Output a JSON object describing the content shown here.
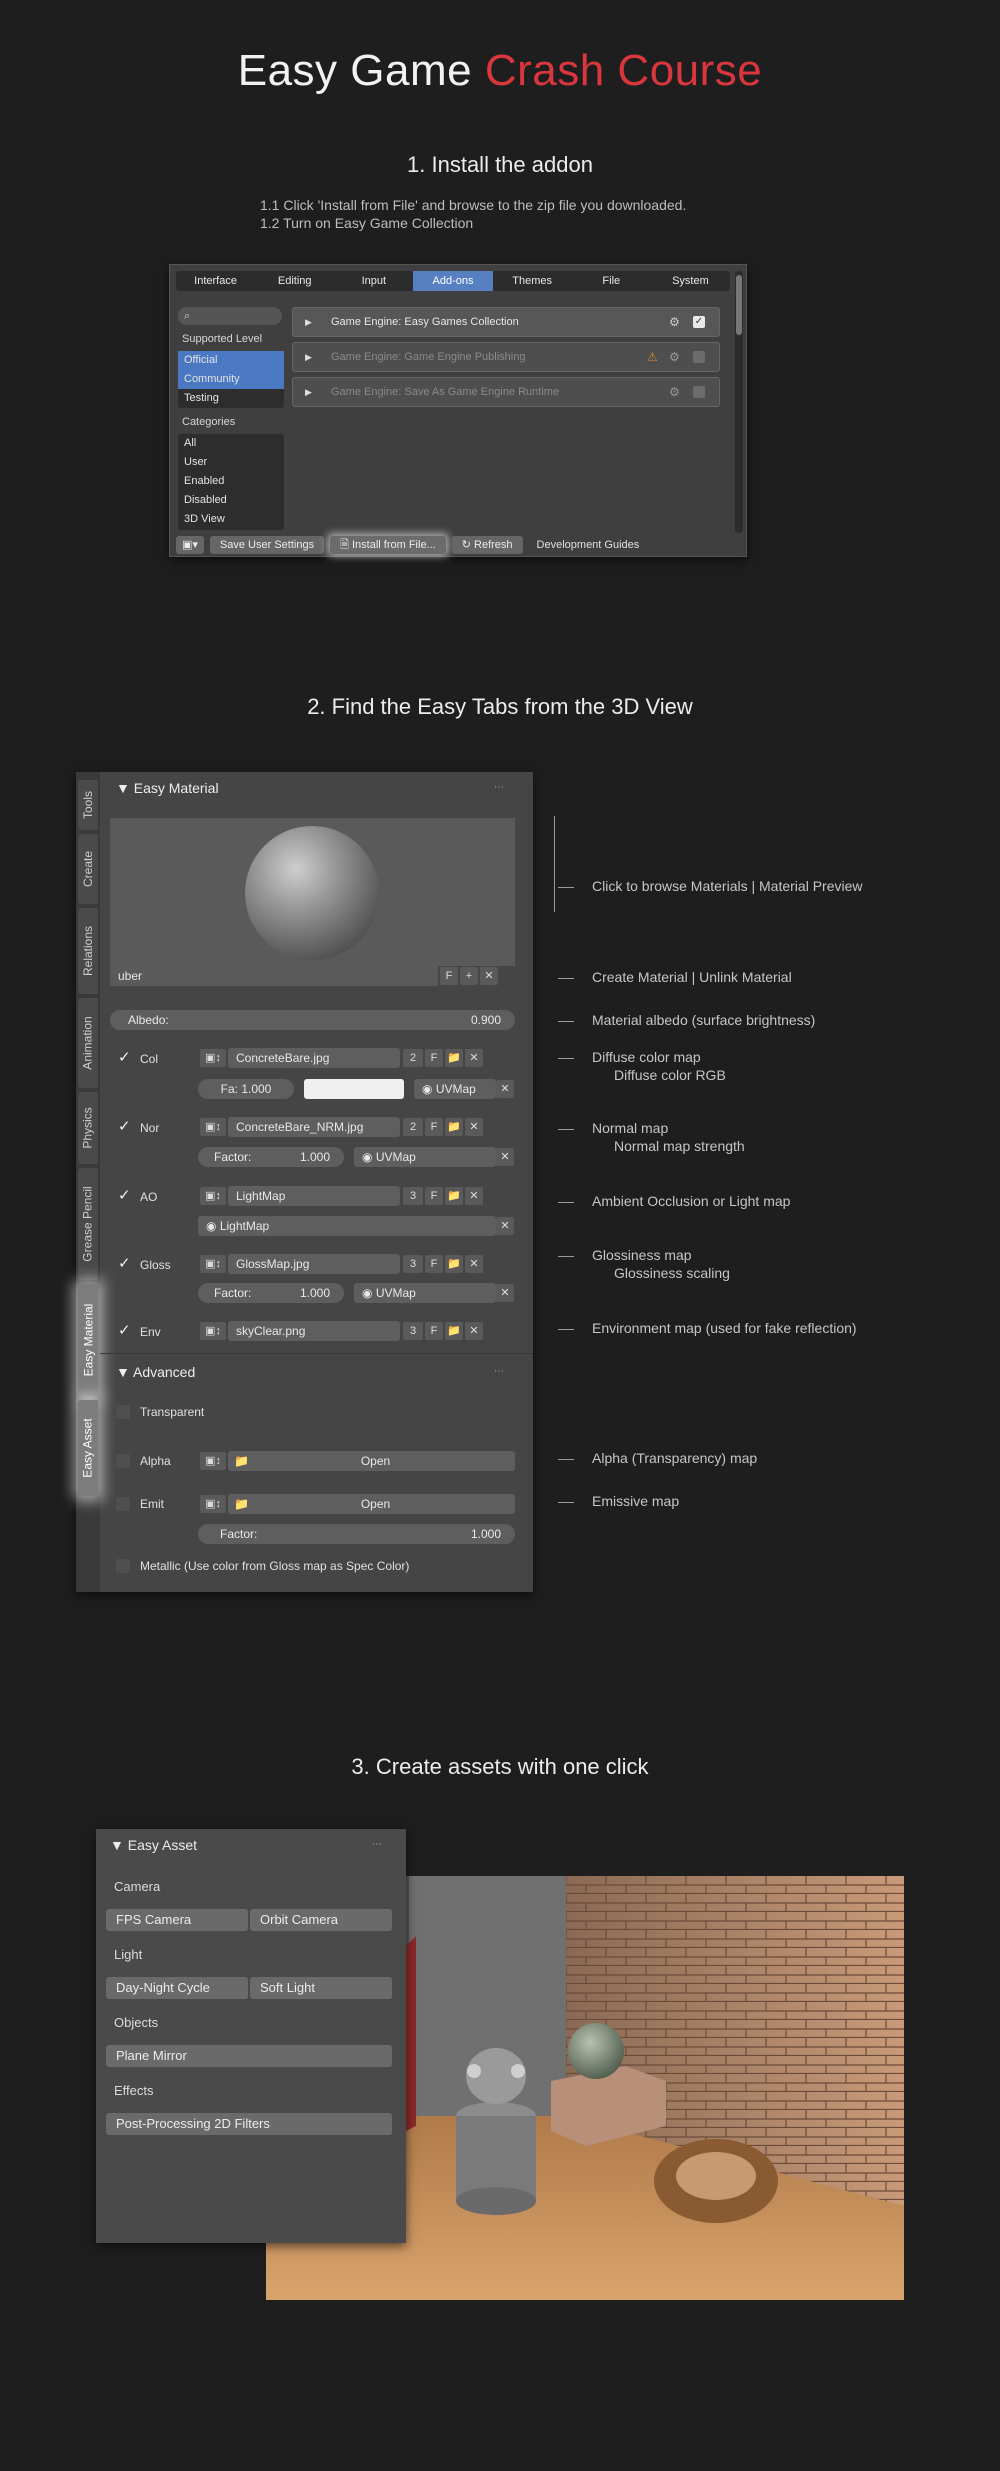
{
  "page": {
    "title_plain": "Easy Game ",
    "title_accent": "Crash Course",
    "accent_color": "#d9363e"
  },
  "step1": {
    "heading": "1. Install the addon",
    "lines": [
      "1.1 Click 'Install from File' and browse to the zip file you downloaded.",
      "1.2 Turn on Easy Game Collection"
    ],
    "tabs": [
      "Interface",
      "Editing",
      "Input",
      "Add-ons",
      "Themes",
      "File",
      "System"
    ],
    "active_tab": "Add-ons",
    "supported_level_label": "Supported Level",
    "levels": [
      "Official",
      "Community",
      "Testing"
    ],
    "categories_label": "Categories",
    "categories": [
      "All",
      "User",
      "Enabled",
      "Disabled",
      "3D View"
    ],
    "addons": [
      "Game Engine: Easy Games Collection",
      "Game Engine: Game Engine Publishing",
      "Game Engine: Save As Game Engine Runtime"
    ],
    "footer": {
      "save": "Save User Settings",
      "install": "Install from File...",
      "refresh": "Refresh",
      "guides": "Development Guides"
    }
  },
  "step2": {
    "heading": "2. Find the Easy Tabs from the 3D View",
    "vtabs": [
      "Tools",
      "Create",
      "Relations",
      "Animation",
      "Physics",
      "Grease Pencil",
      "Easy Material",
      "Easy Asset"
    ],
    "panel_title": "Easy Material",
    "material_name": "uber",
    "f_label": "F",
    "albedo_label": "Albedo:",
    "albedo_value": "0.900",
    "rows": {
      "col": {
        "label": "Col",
        "file": "ConcreteBare.jpg",
        "users": "2",
        "fa": "Fa: 1.000",
        "uv": "UVMap"
      },
      "nor": {
        "label": "Nor",
        "file": "ConcreteBare_NRM.jpg",
        "users": "2",
        "factor_label": "Factor:",
        "factor_value": "1.000",
        "uv": "UVMap"
      },
      "ao": {
        "label": "AO",
        "file": "LightMap",
        "users": "3",
        "uv": "LightMap"
      },
      "gloss": {
        "label": "Gloss",
        "file": "GlossMap.jpg",
        "users": "3",
        "factor_label": "Factor:",
        "factor_value": "1.000",
        "uv": "UVMap"
      },
      "env": {
        "label": "Env",
        "file": "skyClear.png",
        "users": "3"
      }
    },
    "advanced_title": "Advanced",
    "transparent_label": "Transparent",
    "alpha_label": "Alpha",
    "emit_label": "Emit",
    "open_label": "Open",
    "emit_factor_label": "Factor:",
    "emit_factor_value": "1.000",
    "metallic_label": "Metallic (Use color from Gloss map as Spec Color)",
    "annotations": {
      "browse": "Click to browse Materials | Material Preview",
      "create": "Create Material  | Unlink Material",
      "albedo": "Material albedo (surface brightness)",
      "diffuse": "Diffuse color map",
      "diffuse_rgb": "Diffuse color RGB",
      "normal": "Normal map",
      "normal_strength": "Normal map strength",
      "ao": "Ambient Occlusion or Light map",
      "gloss": "Glossiness map",
      "gloss_scale": "Glossiness scaling",
      "env": "Environment map (used for fake reflection)",
      "alpha": "Alpha (Transparency) map",
      "emit": "Emissive map"
    }
  },
  "step3": {
    "heading": "3. Create assets with one click",
    "panel_title": "Easy Asset",
    "camera_label": "Camera",
    "fps_camera": "FPS Camera",
    "orbit_camera": "Orbit Camera",
    "light_label": "Light",
    "day_night": "Day-Night Cycle",
    "soft_light": "Soft Light",
    "objects_label": "Objects",
    "plane_mirror": "Plane Mirror",
    "effects_label": "Effects",
    "post_processing": "Post-Processing 2D Filters"
  }
}
